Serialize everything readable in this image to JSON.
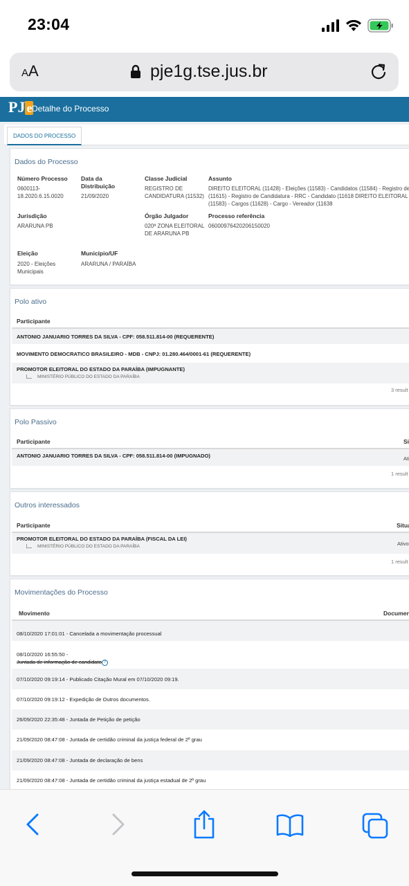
{
  "status_bar": {
    "time": "23:04"
  },
  "safari": {
    "aa_label_big": "A",
    "aa_label_small": "A",
    "url": "pje1g.tse.jus.br"
  },
  "pje": {
    "logo_p": "PJ",
    "logo_e": "e",
    "page_title": "Detalhe do Processo",
    "tab_label": "DADOS DO PROCESSO"
  },
  "dados": {
    "title": "Dados do Processo",
    "numero_label": "Número Processo",
    "numero_value": "0600113-\n18.2020.6.15.0020",
    "data_label": "Data da\nDistribuição",
    "data_value": "21/09/2020",
    "classe_label": "Classe Judicial",
    "classe_value": "REGISTRO DE\nCANDIDATURA (11532)",
    "assunto_label": "Assunto",
    "assunto_value": "DIREITO ELEITORAL (11428) - Eleições (11583) - Candidatos (11584) - Registro de\n(11615) - Registro de Candidatura - RRC - Candidato (11618 DIREITO ELEITORAL (\n(11583) - Cargos (11628) - Cargo - Vereador (11638",
    "jurisdicao_label": "Jurisdição",
    "jurisdicao_value": "ARARUNA PB",
    "orgao_label": "Órgão Julgador",
    "orgao_value": "020ª ZONA ELEITORAL\nDE ARARUNA PB",
    "ref_label": "Processo referência",
    "ref_value": "06000976420206150020",
    "eleicao_label": "Eleição",
    "eleicao_value": "2020 - Eleições\nMunicipais",
    "municipio_label": "Município/UF",
    "municipio_value": "ARARUNA / PARAÍBA"
  },
  "polo_ativo": {
    "title": "Polo ativo",
    "col_participante": "Participante",
    "rows": [
      {
        "name": "ANTONIO JANUARIO TORRES DA SILVA - CPF: 058.511.814-00 (REQUERENTE)"
      },
      {
        "name": "MOVIMENTO DEMOCRATICO BRASILEIRO - MDB - CNPJ: 01.280.464/0001-61 (REQUERENTE)"
      },
      {
        "name": "PROMOTOR ELEITORAL DO ESTADO DA PARAÍBA (IMPUGNANTE)",
        "sub": "MINISTÉRIO PÚBLICO DO ESTADO DA PARAÍBA"
      }
    ],
    "results": "3 result"
  },
  "polo_passivo": {
    "title": "Polo Passivo",
    "col_participante": "Participante",
    "col_situacao": "Si",
    "rows": [
      {
        "name": "ANTONIO JANUARIO TORRES DA SILVA - CPF: 058.511.814-00 (IMPUGNADO)",
        "situacao": "Ati"
      }
    ],
    "results": "1 result"
  },
  "outros": {
    "title": "Outros interessados",
    "col_participante": "Participante",
    "col_situacao": "Situa",
    "rows": [
      {
        "name": "PROMOTOR ELEITORAL DO ESTADO DA PARAÍBA (FISCAL DA LEI)",
        "sub": "MINISTÉRIO PÚBLICO DO ESTADO DA PARAÍBA",
        "situacao": "Ativo"
      }
    ],
    "results": "1 result"
  },
  "movimentacoes": {
    "title": "Movimentações do Processo",
    "col_movimento": "Movimento",
    "col_documento": "Documen",
    "rows": [
      {
        "text": "08/10/2020 17:01:01 - Cancelada a movimentação processual"
      },
      {
        "text": "08/10/2020 16:55:50 -",
        "strike": "Juntada de informação de candidato"
      },
      {
        "text": "07/10/2020 09:19:14 - Publicado Citação Mural em 07/10/2020 09:19."
      },
      {
        "text": "07/10/2020 09:19:12 - Expedição de Outros documentos."
      },
      {
        "text": "26/09/2020 22:35:48 - Juntada de Petição de petição"
      },
      {
        "text": "21/09/2020 08:47:08 - Juntada de certidão criminal da justiça federal de 2º grau"
      },
      {
        "text": "21/09/2020 08:47:08 - Juntada de declaração de bens"
      },
      {
        "text": "21/09/2020 08:47:08 - Juntada de certidão criminal da justiça estadual de 2º grau"
      }
    ]
  },
  "colors": {
    "pje_blue": "#1a6f9e",
    "ios_blue": "#0a7aff",
    "battery_green": "#34c759"
  },
  "icons": [
    "signal-icon",
    "wifi-icon",
    "battery-icon",
    "lock-icon",
    "reload-icon",
    "back-icon",
    "forward-icon",
    "share-icon",
    "bookmarks-icon",
    "tabs-icon",
    "help-icon"
  ]
}
